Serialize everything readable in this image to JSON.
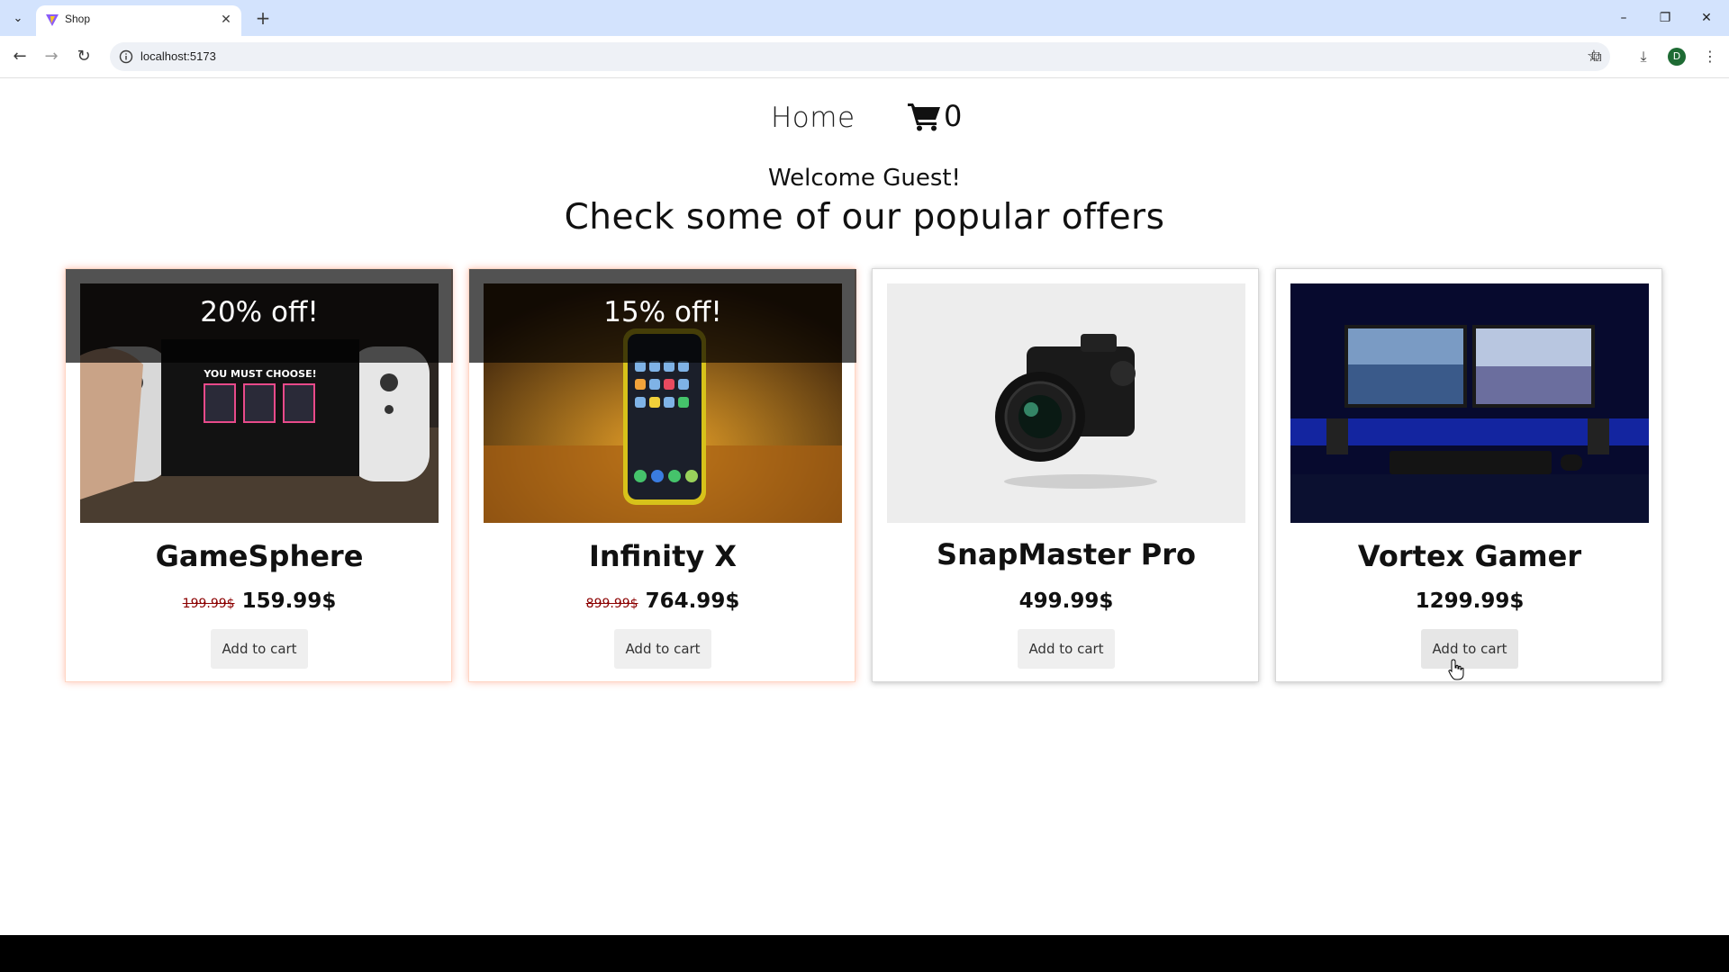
{
  "browser": {
    "tab_title": "Shop",
    "url": "localhost:5173",
    "profile_initial": "D"
  },
  "nav": {
    "home_label": "Home",
    "cart_count": "0"
  },
  "welcome": "Welcome Guest!",
  "headline": "Check some of our popular offers",
  "button_label": "Add to cart",
  "products": [
    {
      "name": "GameSphere",
      "discount": "20% off!",
      "old_price": "199.99$",
      "price": "159.99$"
    },
    {
      "name": "Infinity X",
      "discount": "15% off!",
      "old_price": "899.99$",
      "price": "764.99$"
    },
    {
      "name": "SnapMaster Pro",
      "price": "499.99$"
    },
    {
      "name": "Vortex Gamer",
      "price": "1299.99$"
    }
  ],
  "colors": {
    "tab_strip": "#d3e3fd",
    "sale_glow": "#ffb89a",
    "old_price": "#8b0000",
    "taskbar": "#000000"
  }
}
